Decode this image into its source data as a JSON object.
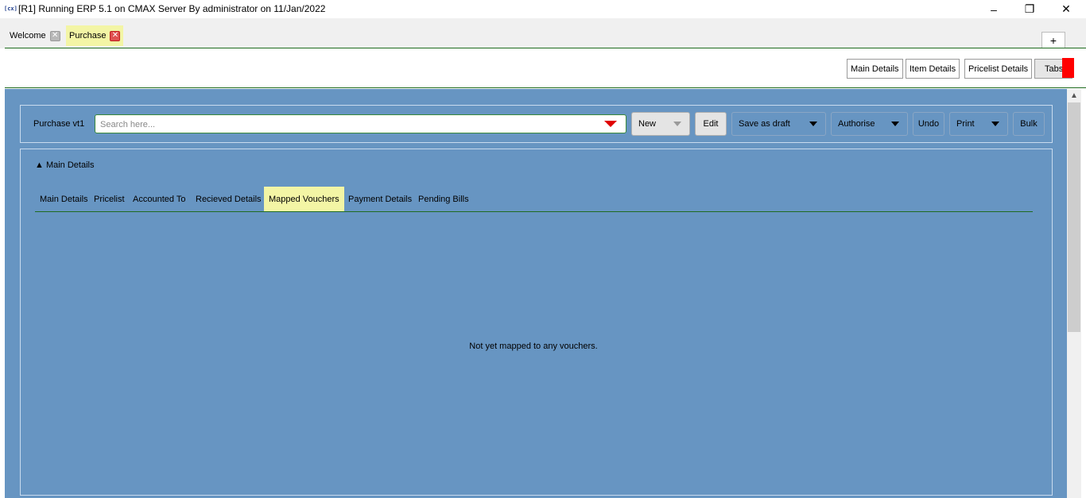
{
  "window": {
    "icon": "[cx]",
    "title": "[R1] Running ERP 5.1 on CMAX Server By administrator on 11/Jan/2022",
    "minimize_glyph": "–",
    "restore_glyph": "❐",
    "close_glyph": "✕"
  },
  "doc_tabs": [
    {
      "label": "Welcome",
      "active": false,
      "close_glyph": "✕"
    },
    {
      "label": "Purchase",
      "active": true,
      "close_glyph": "✕"
    }
  ],
  "new_tab_glyph": "+",
  "top_panel": {
    "buttons": [
      {
        "label": "Main Details"
      },
      {
        "label": "Item Details"
      },
      {
        "label": "Pricelist Details"
      },
      {
        "label": "Tabs"
      }
    ]
  },
  "toolbar": {
    "label": "Purchase vt1",
    "search_placeholder": "Search here...",
    "search_value": "",
    "new_label": "New",
    "edit_label": "Edit",
    "save_draft_label": "Save as draft",
    "authorise_label": "Authorise",
    "undo_label": "Undo",
    "print_label": "Print",
    "bulk_label": "Bulk"
  },
  "section": {
    "toggle_label": "▲ Main Details",
    "tabs": [
      {
        "label": "Main Details",
        "active": false
      },
      {
        "label": "Pricelist",
        "active": false
      },
      {
        "label": "Accounted To",
        "active": false
      },
      {
        "label": "Recieved Details",
        "active": false
      },
      {
        "label": "Mapped Vouchers",
        "active": true
      },
      {
        "label": "Payment Details",
        "active": false
      },
      {
        "label": "Pending Bills",
        "active": false
      }
    ],
    "empty_message": "Not yet mapped to any vouchers."
  },
  "colors": {
    "main_bg": "#6795c2",
    "highlight": "#f3f5a5",
    "accent_line": "#1f6b1f",
    "dropdown_arrow": "#e00000"
  }
}
